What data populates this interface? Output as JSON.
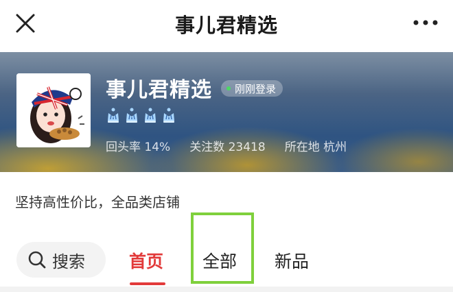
{
  "header": {
    "title": "事儿君精选"
  },
  "shop": {
    "name": "事儿君精选",
    "login_status": "刚刚登录",
    "stats": [
      {
        "label": "回头率",
        "value": "14%"
      },
      {
        "label": "关注数",
        "value": "23418"
      },
      {
        "label": "所在地",
        "value": "杭州"
      }
    ],
    "crown_count": 4,
    "slogan": "坚持高性价比，全品类店铺"
  },
  "tabs": {
    "search_label": "搜索",
    "items": [
      "首页",
      "全部",
      "新品"
    ],
    "active": "首页",
    "highlighted": "全部"
  },
  "colors": {
    "accent_red": "#e23a3a",
    "highlight_green": "#7fd03c",
    "banner_blue": "#2f5482",
    "banner_gold": "#d6aa28"
  }
}
